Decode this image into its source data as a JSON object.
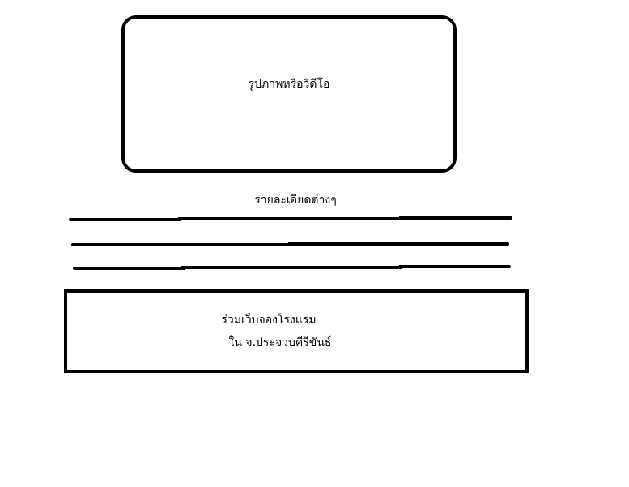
{
  "media": {
    "label": "รูปภาพหรือวิดีโอ"
  },
  "details": {
    "label": "รายละเอียดต่างๆ"
  },
  "cta": {
    "line1": "ร่วมเว็บจองโรงแรม",
    "line2": "ใน จ.ประจวบคีรีขันธ์"
  }
}
